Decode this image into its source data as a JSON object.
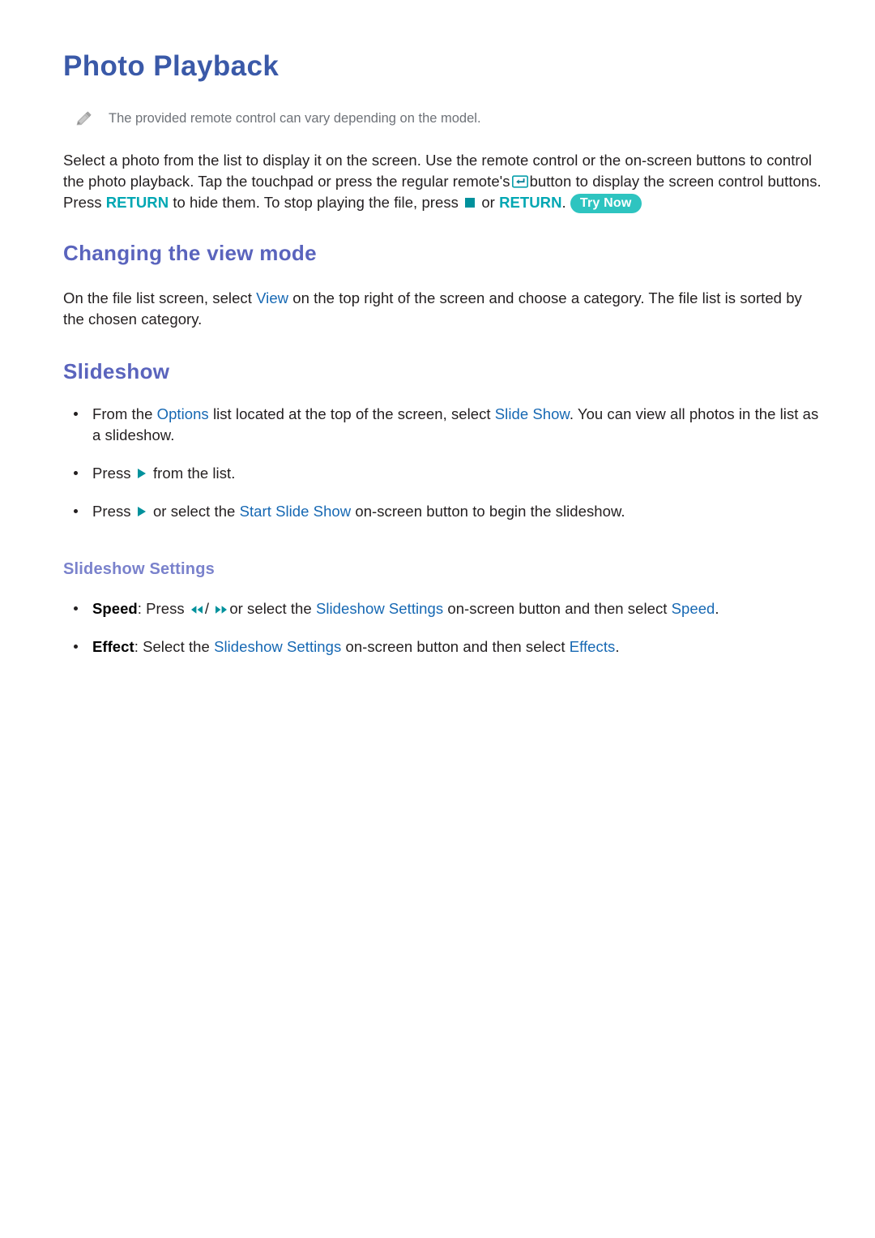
{
  "document": {
    "title": "Photo Playback",
    "note": {
      "icon": "pencil-icon",
      "text": "The provided remote control can vary depending on the model."
    },
    "intro": {
      "part1": "Select a photo from the list to display it on the screen. Use the remote control or the on-screen buttons to control the photo playback. Tap the touchpad or press the regular remote's",
      "icon_enter": "enter-button-icon",
      "part2": "button to display the screen control buttons. Press",
      "return_kw_1": "RETURN",
      "part3": "to hide them. To stop playing the file, press",
      "icon_stop": "stop-button-icon",
      "part4": "or",
      "return_kw_2": "RETURN",
      "part5": ".",
      "try_now_badge": "Try Now"
    },
    "sections": [
      {
        "id": "changing-the-view-mode",
        "heading": "Changing the view mode",
        "paragraph": {
          "part1": "On the file list screen, select",
          "kw_view": "View",
          "part2": "on the top right of the screen and choose a category. The file list is sorted by the chosen category."
        }
      },
      {
        "id": "slideshow",
        "heading": "Slideshow",
        "bullets": [
          {
            "part1": "From the",
            "kw1": "Options",
            "part2": "list located at the top of the screen, select",
            "kw2": "Slide Show",
            "part3": ". You can view all photos in the list as a slideshow."
          },
          {
            "part1": "Press",
            "icon": "play-button-icon",
            "part2": "from the list."
          },
          {
            "part1": "Press",
            "icon": "play-button-icon",
            "part2": "or select the",
            "kw1": "Start Slide Show",
            "part3": "on-screen button to begin the slideshow."
          }
        ],
        "subsection": {
          "id": "slideshow-settings",
          "heading": "Slideshow Settings",
          "bullets": [
            {
              "label": "Speed",
              "part1": ": Press",
              "icon_rw": "rewind-button-icon",
              "separator": "/",
              "icon_ff": "fast-forward-button-icon",
              "part2": "or select the",
              "kw1": "Slideshow Settings",
              "part3": "on-screen button and then select",
              "kw2": "Speed",
              "part4": "."
            },
            {
              "label": "Effect",
              "part1": ": Select the",
              "kw1": "Slideshow Settings",
              "part2": "on-screen button and then select",
              "kw2": "Effects",
              "part3": "."
            }
          ]
        }
      }
    ],
    "colors": {
      "title_blue": "#3a59a8",
      "heading_purple": "#5a64bd",
      "subheading_purple": "#7a82cc",
      "keyword_blue": "#1668b3",
      "keyword_teal": "#00a7b3",
      "badge_teal": "#2ec4c0",
      "icon_teal": "#00919c",
      "body_text": "#231f20",
      "note_text": "#6e7278"
    }
  }
}
